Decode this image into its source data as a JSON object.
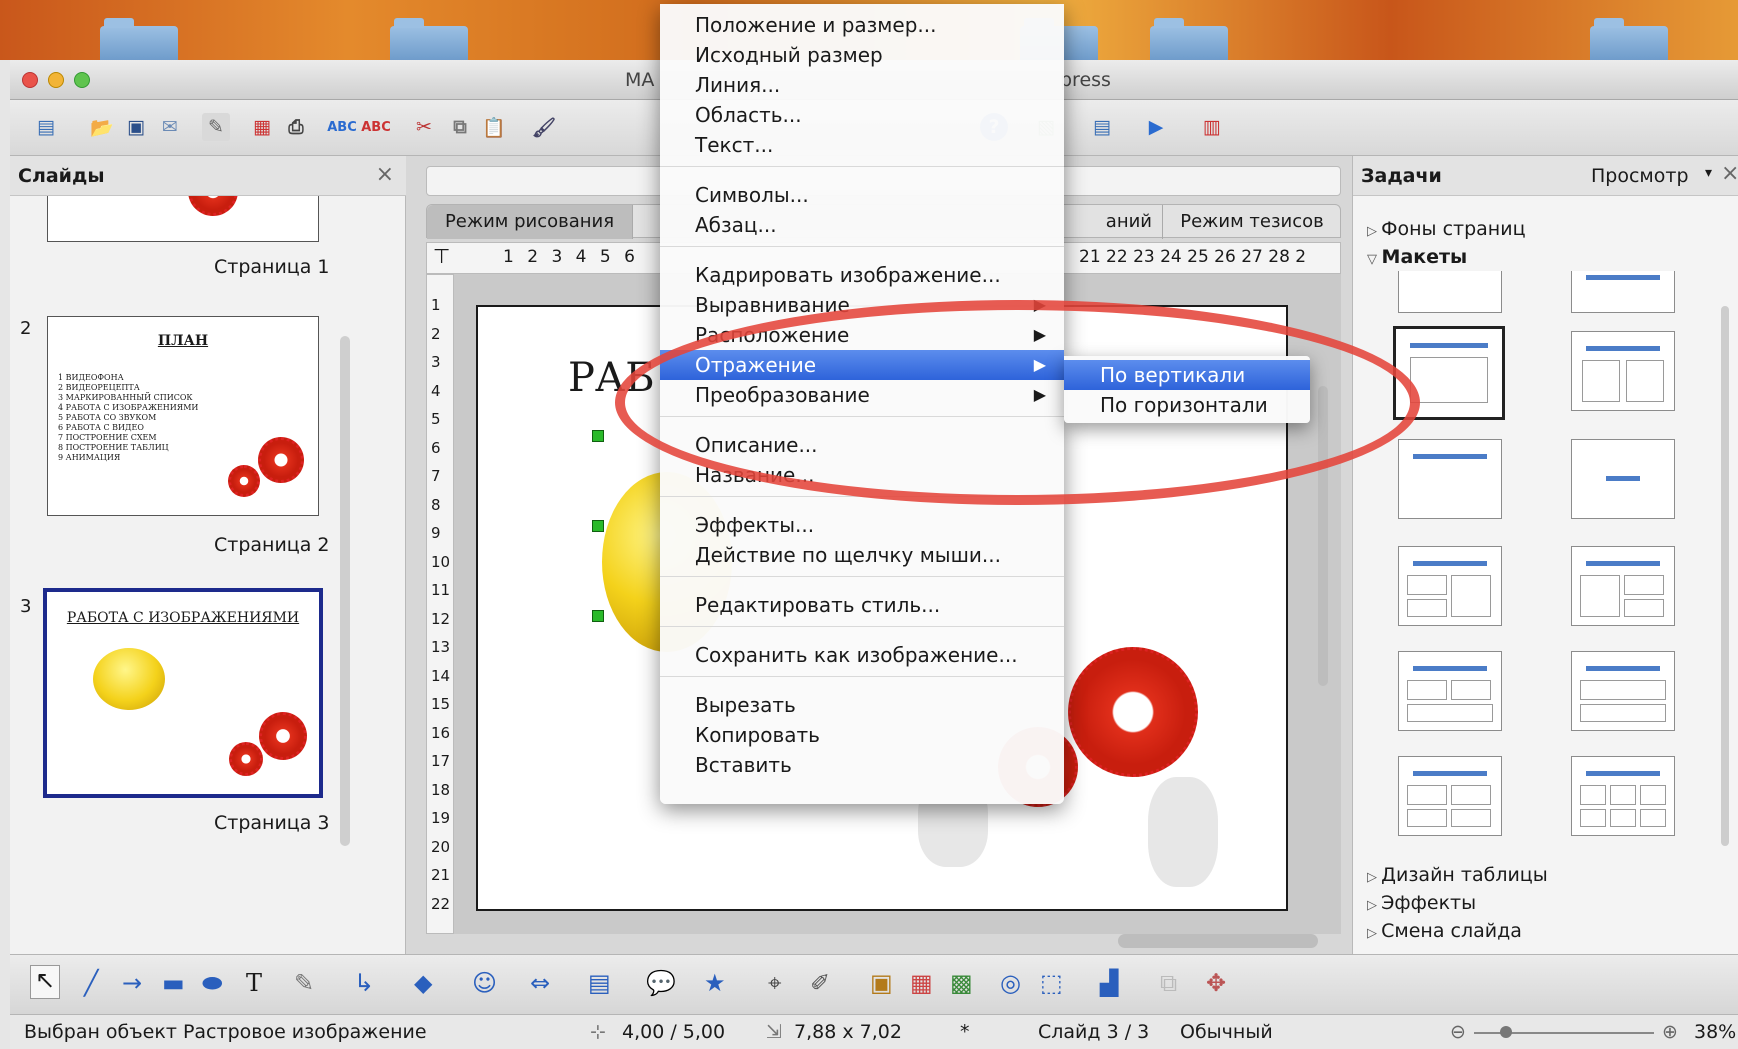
{
  "window": {
    "title_left": "MA",
    "title_right": "press"
  },
  "slides_pane": {
    "title": "Слайды",
    "close": "×",
    "thumbs": [
      {
        "caption": "Страница 1"
      },
      {
        "number": "2",
        "title": "ПЛАН",
        "lines": [
          "1 ВИДЕОФОНА",
          "2 ВИДЕОРЕЦЕПТА",
          "3 МАРКИРОВАННЫЙ СПИСОК",
          "4 РАБОТА С ИЗОБРАЖЕНИЯМИ",
          "5 РАБОТА СО ЗВУКОМ",
          "6 РАБОТА С ВИДЕО",
          "7 ПОСТРОЕНИЕ СХЕМ",
          "8 ПОСТРОЕНИЕ ТАБЛИЦ",
          "9 АНИМАЦИЯ"
        ],
        "caption": "Страница 2"
      },
      {
        "number": "3",
        "title": "РАБОТА С ИЗОБРАЖЕНИЯМИ",
        "caption": "Страница 3"
      }
    ]
  },
  "view_tabs": [
    "Режим рисования",
    "аний",
    "Режим тезисов"
  ],
  "ruler": {
    "h_left": "1 2 3 4 5 6",
    "h_right": "21 22 23 24 25 26 27 28 2",
    "v": [
      "1",
      "2",
      "3",
      "4",
      "5",
      "6",
      "7",
      "8",
      "9",
      "10",
      "11",
      "12",
      "13",
      "14",
      "15",
      "16",
      "17",
      "18",
      "19",
      "20",
      "21",
      "22"
    ]
  },
  "slide": {
    "title": "РАБ"
  },
  "context_menu": {
    "items": [
      {
        "label": "Положение и размер...",
        "submenu": false
      },
      {
        "label": "Исходный размер",
        "submenu": false
      },
      {
        "label": "Линия...",
        "submenu": false
      },
      {
        "label": "Область...",
        "submenu": false
      },
      {
        "label": "Текст...",
        "submenu": false
      },
      {
        "label": "Символы...",
        "submenu": false
      },
      {
        "label": "Абзац...",
        "submenu": false
      },
      {
        "label": "Кадрировать изображение...",
        "submenu": false
      },
      {
        "label": "Выравнивание",
        "submenu": true
      },
      {
        "label": "Расположение",
        "submenu": true
      },
      {
        "label": "Отражение",
        "submenu": true,
        "active": true
      },
      {
        "label": "Преобразование",
        "submenu": true
      },
      {
        "label": "Описание...",
        "submenu": false
      },
      {
        "label": "Название...",
        "submenu": false
      },
      {
        "label": "Эффекты...",
        "submenu": false
      },
      {
        "label": "Действие по щелчку мыши...",
        "submenu": false
      },
      {
        "label": "Редактировать стиль...",
        "submenu": false
      },
      {
        "label": "Сохранить как изображение...",
        "submenu": false
      },
      {
        "label": "Вырезать",
        "submenu": false
      },
      {
        "label": "Копировать",
        "submenu": false
      },
      {
        "label": "Вставить",
        "submenu": false
      }
    ],
    "submenu": [
      "По вертикали",
      "По горизонтали"
    ]
  },
  "tasks_pane": {
    "title": "Задачи",
    "view_label": "Просмотр",
    "sections": [
      "Фоны страниц",
      "Макеты",
      "Дизайн таблицы",
      "Эффекты",
      "Смена слайда"
    ]
  },
  "status": {
    "selection": "Выбран объект Растровое изображение",
    "position": "4,00 / 5,00",
    "size": "7,88 x 7,02",
    "modified": "*",
    "slide": "Слайд 3 / 3",
    "layout": "Обычный",
    "zoom": "38%"
  },
  "colors": {
    "accent": "#2e63da",
    "annotation": "#e4443a",
    "handle": "#2aba2a"
  }
}
